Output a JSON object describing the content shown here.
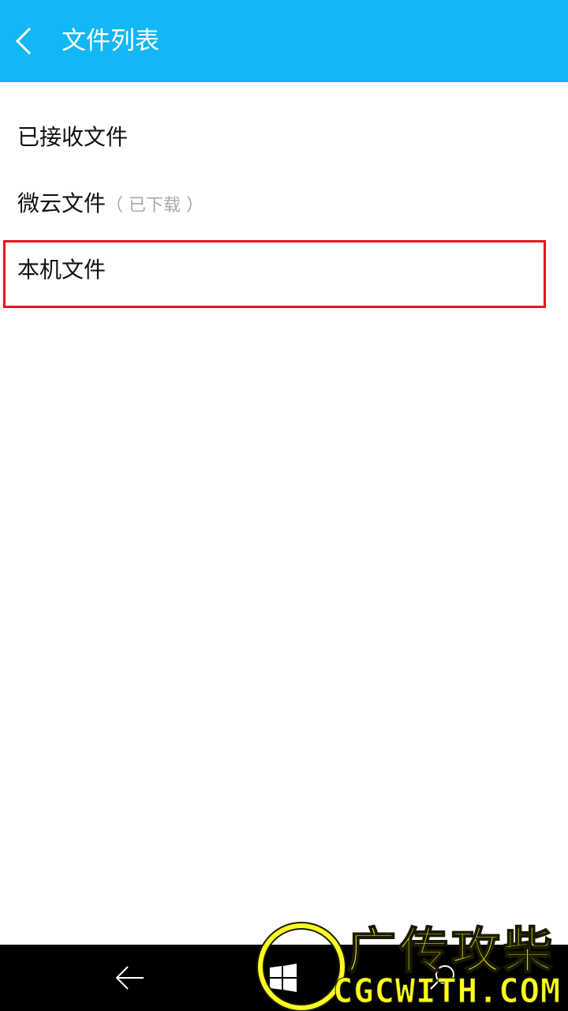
{
  "header": {
    "title": "文件列表",
    "back_icon": "chevron-left-icon",
    "background": "#12b7f5"
  },
  "file_sources": [
    {
      "label": "已接收文件",
      "note": ""
    },
    {
      "label": "微云文件",
      "note": "（ 已下载 ）"
    },
    {
      "label": "本机文件",
      "note": ""
    }
  ],
  "highlight_color": "#e8141e",
  "navbar": {
    "back_icon": "arrow-left-icon",
    "home_icon": "windows-logo-icon",
    "search_icon": "search-icon"
  },
  "watermark": {
    "chinese": "广传攻柴",
    "domain": "CGCWITH.COM",
    "color": "#ffff1e"
  }
}
